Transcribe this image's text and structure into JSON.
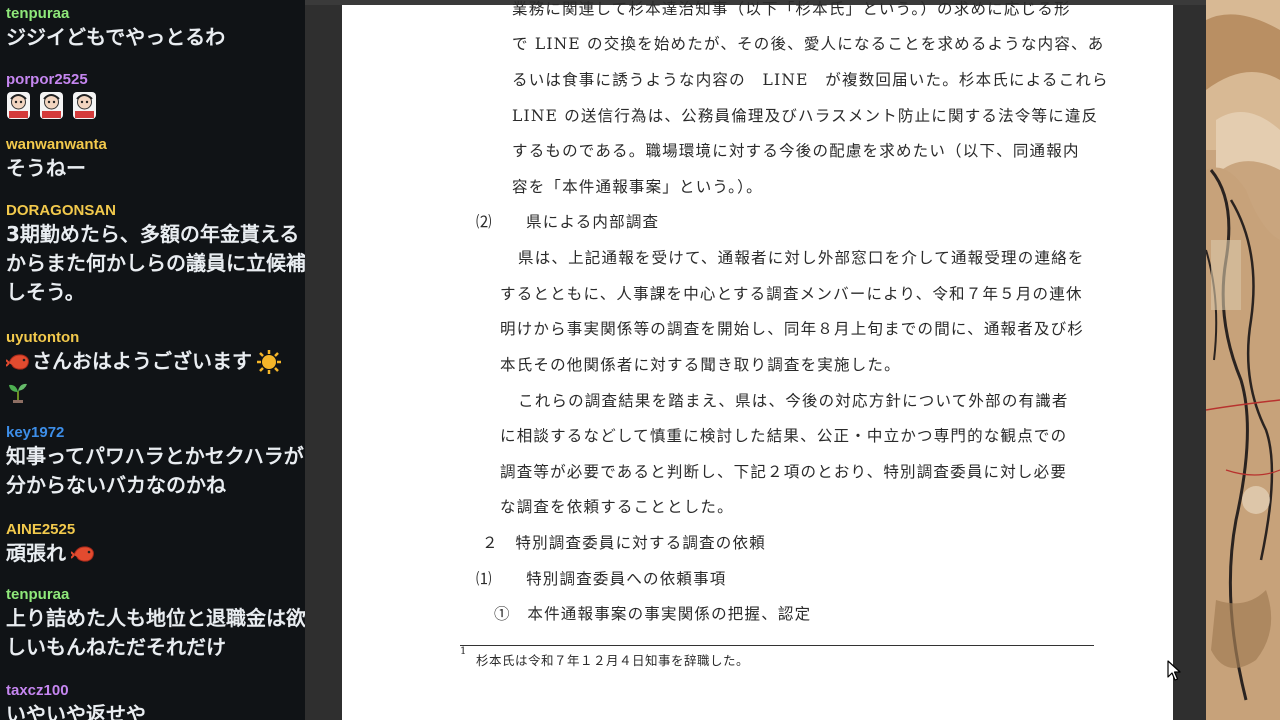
{
  "chat": {
    "messages": [
      {
        "user": "tenpuraa",
        "color": "#8fe87a",
        "text": "ジジイどもでやっとるわ"
      },
      {
        "user": "porpor2525",
        "color": "#c586f0",
        "text": "",
        "stamps": 3
      },
      {
        "user": "wanwanwanta",
        "color": "#f2c94c",
        "text": "そうねー"
      },
      {
        "user": "DORAGONSAN",
        "color": "#f2c94c",
        "text": "3期勤めたら、多額の年金貰えるからまた何かしらの議員に立候補しそう。"
      },
      {
        "user": "uyutonton",
        "color": "#f2c94c",
        "text": "さんおはようございます",
        "pre_icon": "shrimp-icon",
        "post_icons": [
          "sun-icon",
          "sprout-icon"
        ]
      },
      {
        "user": "key1972",
        "color": "#3d8ee8",
        "text": "知事ってパワハラとかセクハラが分からないバカなのかね"
      },
      {
        "user": "AINE2525",
        "color": "#f2c94c",
        "text": "頑張れ",
        "post_icons": [
          "shrimp-icon"
        ]
      },
      {
        "user": "tenpuraa",
        "color": "#8fe87a",
        "text": "上り詰めた人も地位と退職金は欲しいもんねただそれだけ"
      },
      {
        "user": "taxcz100",
        "color": "#c586f0",
        "text": "いやいや返せや"
      }
    ]
  },
  "document": {
    "lines": [
      "業務に関連して杉本達治知事（以下「杉本氏」という。）の求めに応じる形",
      "で LINE の交換を始めたが、その後、愛人になることを求めるような内容、あ",
      "るいは食事に誘うような内容の　LINE　が複数回届いた。杉本氏によるこれら",
      "LINE の送信行為は、公務員倫理及びハラスメント防止に関する法令等に違反",
      "するものである。職場環境に対する今後の配慮を求めたい（以下、同通報内",
      "容を「本件通報事案」という。）。",
      "⑵　　県による内部調査",
      "県は、上記通報を受けて、通報者に対し外部窓口を介して通報受理の連絡を",
      "するとともに、人事課を中心とする調査メンバーにより、令和７年５月の連休",
      "明けから事実関係等の調査を開始し、同年８月上旬までの間に、通報者及び杉",
      "本氏その他関係者に対する聞き取り調査を実施した。",
      "これらの調査結果を踏まえ、県は、今後の対応方針について外部の有識者",
      "に相談するなどして慎重に検討した結果、公正・中立かつ専門的な観点での",
      "調査等が必要であると判断し、下記２項のとおり、特別調査委員に対し必要",
      "な調査を依頼することとした。",
      "２　特別調査委員に対する調査の依頼",
      "⑴　　特別調査委員への依頼事項",
      "①　本件通報事案の事実関係の把握、認定"
    ],
    "footnote_mark": "1",
    "footnote": "杉本氏は令和７年１２月４日知事を辞職した。"
  }
}
